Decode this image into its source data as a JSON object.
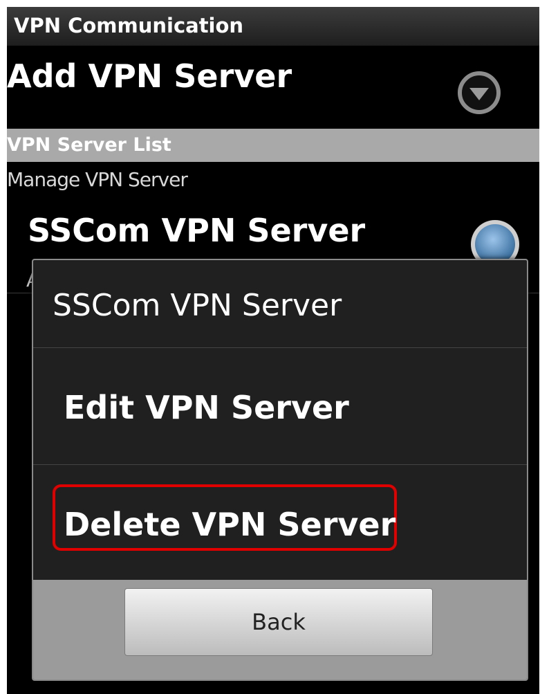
{
  "title_bar": {
    "title": "VPN Communication"
  },
  "add_server": {
    "label": "Add VPN Server",
    "icon": "chevron-down-circle-icon"
  },
  "server_list": {
    "header": "VPN Server List",
    "subheader": "Manage VPN Server",
    "items": [
      {
        "name": "SSCom VPN Server",
        "radio_icon": "radio-button-icon",
        "partial_sub": "A"
      }
    ]
  },
  "dialog": {
    "title": "SSCom VPN Server",
    "items": [
      {
        "label": "Edit VPN Server"
      },
      {
        "label": "Delete VPN Server",
        "highlighted": true
      }
    ],
    "back_button": "Back"
  },
  "colors": {
    "background": "#000000",
    "section_header": "#a9a9a9",
    "dialog_bg": "#202020",
    "highlight": "#e00000",
    "radio_fill": "#5b8fc0"
  }
}
